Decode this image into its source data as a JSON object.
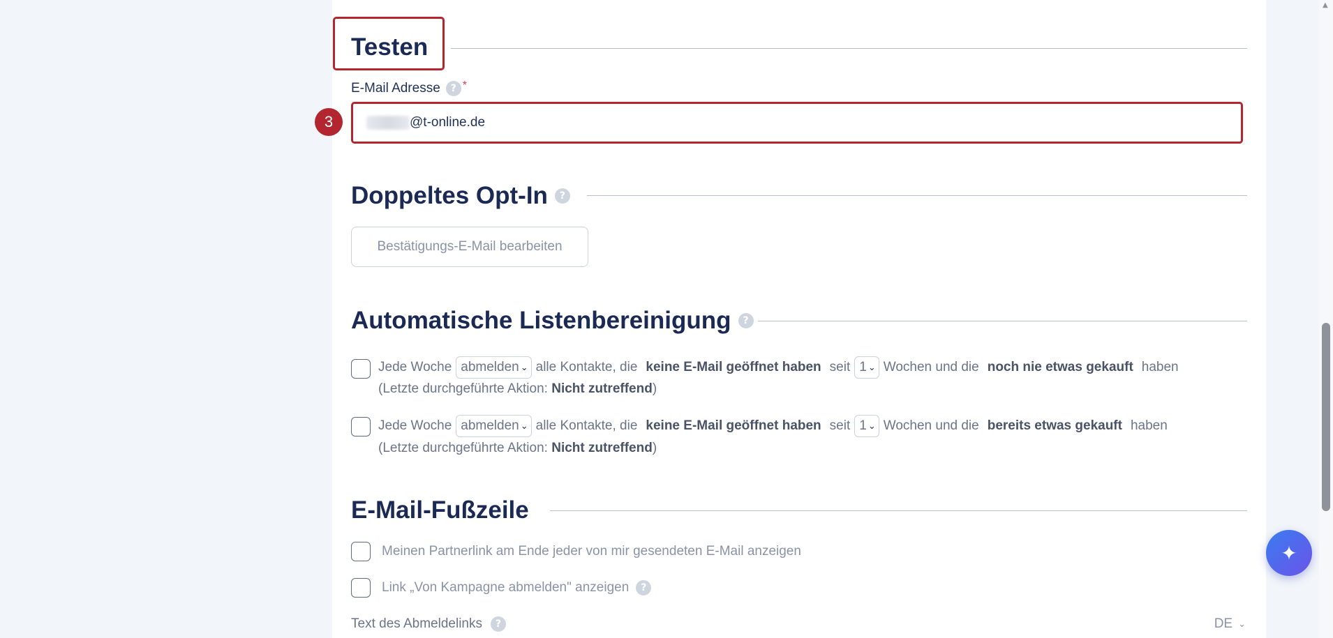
{
  "testen": {
    "title": "Testen",
    "email_label": "E-Mail Adresse",
    "required_mark": "*",
    "email_value": "@t-online.de",
    "step_badge": "3"
  },
  "double_opt_in": {
    "title": "Doppeltes Opt-In",
    "edit_button": "Bestätigungs-E-Mail bearbeiten"
  },
  "list_cleanup": {
    "title": "Automatische Listenbereinigung",
    "rules": [
      {
        "prefix": "Jede Woche",
        "action": "abmelden",
        "mid1": "alle Kontakte, die",
        "bold1": "keine E-Mail geöffnet haben",
        "mid2": "seit",
        "weeks": "1",
        "mid3": "Wochen und die",
        "bold2": "noch nie etwas gekauft",
        "suffix": "haben",
        "last_action_label": "(Letzte durchgeführte Aktion:",
        "last_action_value": "Nicht zutreffend",
        "last_action_close": ")"
      },
      {
        "prefix": "Jede Woche",
        "action": "abmelden",
        "mid1": "alle Kontakte, die",
        "bold1": "keine E-Mail geöffnet haben",
        "mid2": "seit",
        "weeks": "1",
        "mid3": "Wochen und die",
        "bold2": "bereits etwas gekauft",
        "suffix": "haben",
        "last_action_label": "(Letzte durchgeführte Aktion:",
        "last_action_value": "Nicht zutreffend",
        "last_action_close": ")"
      }
    ]
  },
  "footer": {
    "title": "E-Mail-Fußzeile",
    "option_partner": "Meinen Partnerlink am Ende jeder von mir gesendeten E-Mail anzeigen",
    "option_unsubscribe": "Link „Von Kampagne abmelden\" anzeigen",
    "unsubscribe_text_label": "Text des Abmeldelinks",
    "language": "DE"
  },
  "icons": {
    "help": "help-icon",
    "chevron": "chevron-down-icon",
    "ai": "sparkles-icon"
  },
  "colors": {
    "highlight": "#b3262f",
    "title": "#1b2a55",
    "fab_start": "#3a7cf0",
    "fab_end": "#6b54e8"
  }
}
